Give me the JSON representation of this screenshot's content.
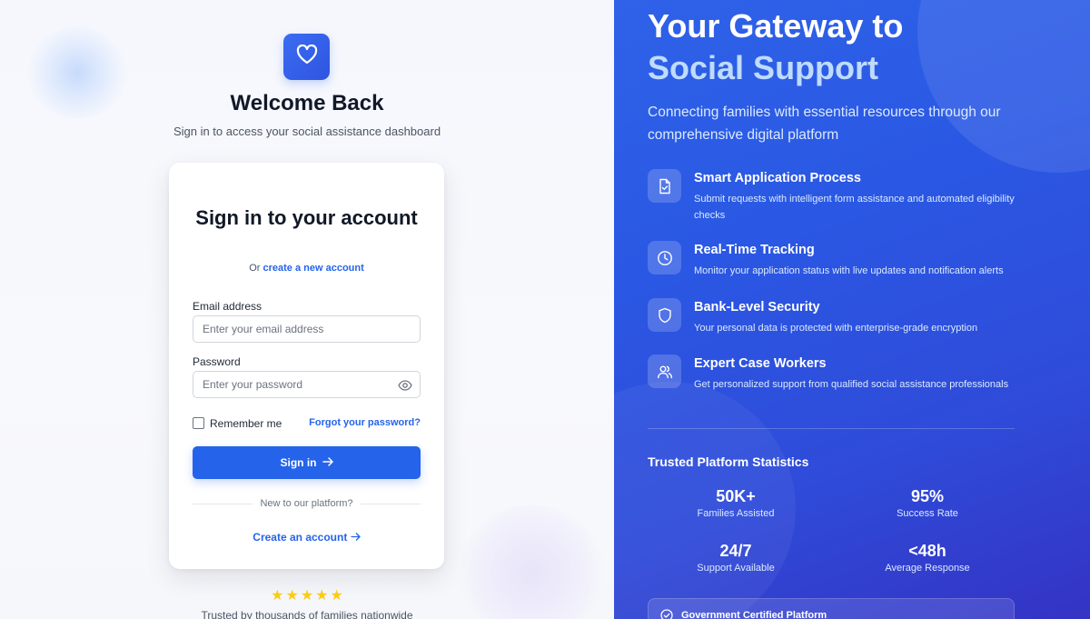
{
  "colors": {
    "brand": "#2563eb",
    "panel": "#2f5be6",
    "highlight": "#bfdbfe",
    "star": "#facc15"
  },
  "left": {
    "logo_icon": "heart-icon",
    "welcome_title": "Welcome Back",
    "welcome_subtitle": "Sign in to access your social assistance dashboard",
    "card": {
      "title": "Sign in to your account",
      "or_prefix": "Or",
      "create_link": "create a new account",
      "email_label": "Email address",
      "email_placeholder": "Enter your email address",
      "email_value": "",
      "password_label": "Password",
      "password_placeholder": "Enter your password",
      "password_value": "",
      "remember_label": "Remember me",
      "remember_checked": false,
      "forgot_label": "Forgot your password?",
      "signin_label": "Sign in",
      "divider_text": "New to our platform?",
      "create_account_label": "Create an account"
    },
    "rating_stars": 5,
    "trusted_text": "Trusted by thousands of families nationwide"
  },
  "right": {
    "hero_line1": "Your Gateway to",
    "hero_line2": "Social Support",
    "hero_subtitle": "Connecting families with essential resources through our comprehensive digital platform",
    "features": [
      {
        "icon": "document-check-icon",
        "title": "Smart Application Process",
        "desc": "Submit requests with intelligent form assistance and automated eligibility checks"
      },
      {
        "icon": "clock-icon",
        "title": "Real-Time Tracking",
        "desc": "Monitor your application status with live updates and notification alerts"
      },
      {
        "icon": "shield-icon",
        "title": "Bank-Level Security",
        "desc": "Your personal data is protected with enterprise-grade encryption"
      },
      {
        "icon": "users-icon",
        "title": "Expert Case Workers",
        "desc": "Get personalized support from qualified social assistance professionals"
      }
    ],
    "stats_title": "Trusted Platform Statistics",
    "stats": [
      {
        "value": "50K+",
        "label": "Families Assisted"
      },
      {
        "value": "95%",
        "label": "Success Rate"
      },
      {
        "value": "24/7",
        "label": "Support Available"
      },
      {
        "value": "<48h",
        "label": "Average Response"
      }
    ],
    "cert_text": "Government Certified Platform"
  }
}
